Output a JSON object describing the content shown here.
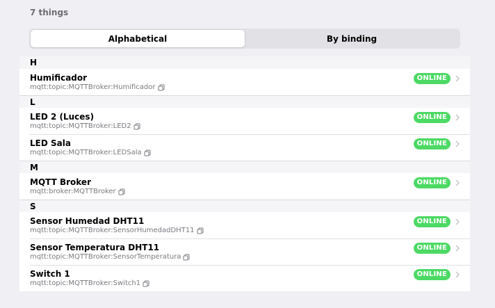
{
  "header": {
    "count_label": "7 things"
  },
  "tabs": [
    {
      "label": "Alphabetical",
      "active": true
    },
    {
      "label": "By binding",
      "active": false
    }
  ],
  "groups": [
    {
      "letter": "H",
      "items": [
        {
          "title": "Humificador",
          "uid": "mqtt:topic:MQTTBroker:Humificador",
          "status": "ONLINE"
        }
      ]
    },
    {
      "letter": "L",
      "items": [
        {
          "title": "LED 2 (Luces)",
          "uid": "mqtt:topic:MQTTBroker:LED2",
          "status": "ONLINE"
        },
        {
          "title": "LED Sala",
          "uid": "mqtt:topic:MQTTBroker:LEDSala",
          "status": "ONLINE"
        }
      ]
    },
    {
      "letter": "M",
      "items": [
        {
          "title": "MQTT Broker",
          "uid": "mqtt:broker:MQTTBroker",
          "status": "ONLINE"
        }
      ]
    },
    {
      "letter": "S",
      "items": [
        {
          "title": "Sensor Humedad DHT11",
          "uid": "mqtt:topic:MQTTBroker:SensorHumedadDHT11",
          "status": "ONLINE"
        },
        {
          "title": "Sensor Temperatura DHT11",
          "uid": "mqtt:topic:MQTTBroker:SensorTemperatura",
          "status": "ONLINE"
        },
        {
          "title": "Switch 1",
          "uid": "mqtt:topic:MQTTBroker:Switch1",
          "status": "ONLINE"
        }
      ]
    }
  ],
  "colors": {
    "online": "#4cd964",
    "accent": "#007aff"
  }
}
